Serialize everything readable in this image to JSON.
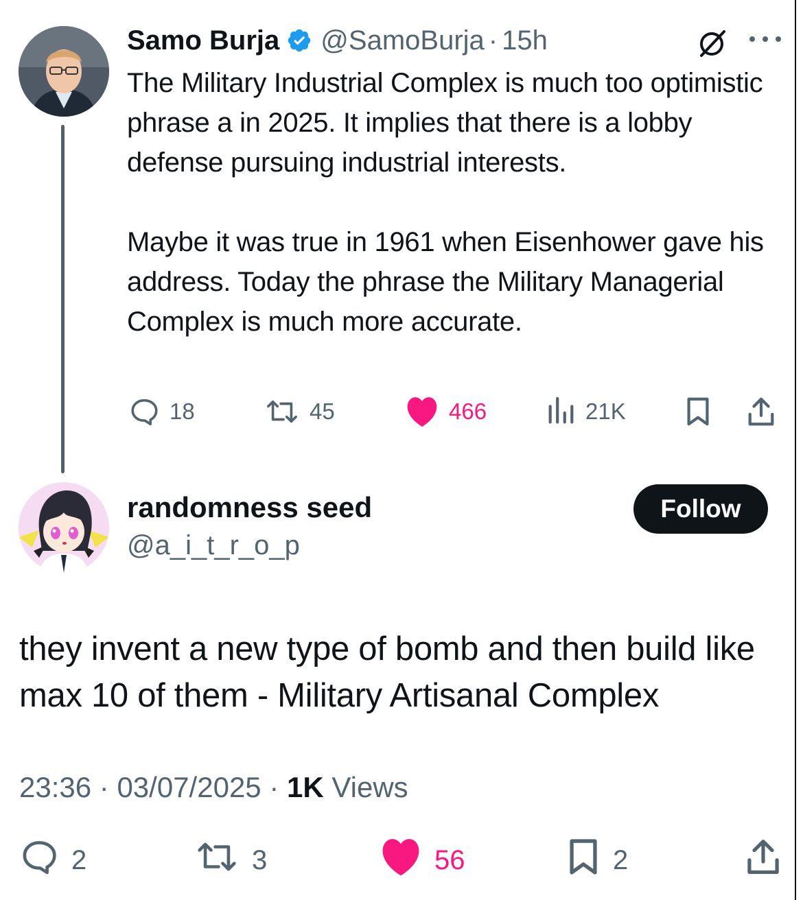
{
  "parent": {
    "author_name": "Samo Burja",
    "handle": "@SamoBurja",
    "separator": "·",
    "time": "15h",
    "paragraphs": [
      "The Military Industrial Complex is much too optimistic phrase a in 2025. It implies that there is a lobby defense pursuing industrial interests.",
      "Maybe it was true in 1961 when Eisenhower gave his address. Today the phrase the Military Managerial Complex is much more accurate."
    ],
    "replies": "18",
    "reposts": "45",
    "likes": "466",
    "views": "21K"
  },
  "reply": {
    "author_name": "randomness seed",
    "handle": "@a_i_t_r_o_p",
    "follow_label": "Follow",
    "text": "they invent a new type of bomb and then build like max 10 of them - Military Artisanal Complex",
    "time": "23:36",
    "sep1": "·",
    "date": "03/07/2025",
    "sep2": "·",
    "views_count": "1K",
    "views_label": "Views",
    "replies": "2",
    "reposts": "3",
    "likes": "56",
    "bookmarks": "2"
  },
  "colors": {
    "text": "#0f1419",
    "secondary": "#536471",
    "like": "#f91880",
    "verified": "#1d9bf0",
    "button": "#0f1419"
  },
  "icons": [
    "verified-badge-icon",
    "grok-icon",
    "more-icon",
    "reply-icon",
    "repost-icon",
    "like-icon",
    "views-icon",
    "bookmark-icon",
    "share-icon"
  ]
}
